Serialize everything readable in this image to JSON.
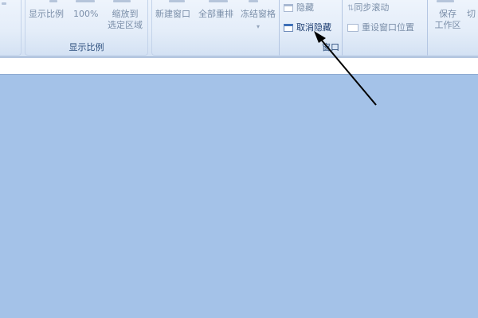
{
  "ribbon": {
    "zoom_group": {
      "label": "显示比例",
      "buttons": [
        {
          "label": "显示比例"
        },
        {
          "label": "100%"
        },
        {
          "label_line1": "缩放到",
          "label_line2": "选定区域"
        }
      ]
    },
    "window_group": {
      "label": "窗口",
      "buttons": {
        "new_window": "新建窗口",
        "arrange_all": "全部重排",
        "freeze_panes": "冻结窗格",
        "hide": "隐藏",
        "unhide": "取消隐藏",
        "side_by_side": "同步滚动",
        "reset_position": "重设窗口位置",
        "save_workspace_line1": "保存",
        "save_workspace_line2": "工作区",
        "switch_window": "切"
      }
    }
  },
  "colors": {
    "workspace": "#a4c2e8",
    "arrow": "#000000",
    "accent": "#1f3f73"
  },
  "icons": [
    "hide-window-icon",
    "unhide-window-icon",
    "sync-scroll-icon",
    "reset-position-icon",
    "dropdown-arrow-icon",
    "annotation-arrow"
  ]
}
